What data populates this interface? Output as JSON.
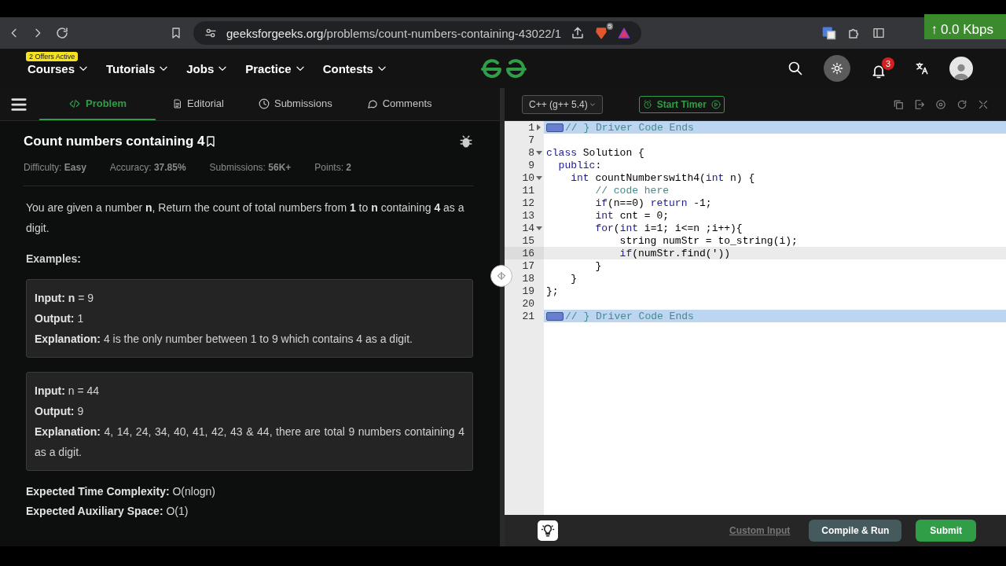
{
  "browser": {
    "url_host": "geeksforgeeks.org",
    "url_path": "/problems/count-numbers-containing-43022/1",
    "shield_count": "5",
    "network_arrow": "↑",
    "network_speed": "0.0 Kbps"
  },
  "nav": {
    "offer_badge": "2 Offers Active",
    "menus": [
      "Courses",
      "Tutorials",
      "Jobs",
      "Practice",
      "Contests"
    ],
    "notification_count": "3"
  },
  "problem_tabs": [
    {
      "label": "Problem",
      "selected": true
    },
    {
      "label": "Editorial",
      "selected": false
    },
    {
      "label": "Submissions",
      "selected": false
    },
    {
      "label": "Comments",
      "selected": false
    }
  ],
  "problem": {
    "title": "Count numbers containing 4",
    "stats": [
      {
        "label": "Difficulty:",
        "value": "Easy"
      },
      {
        "label": "Accuracy:",
        "value": "37.85%"
      },
      {
        "label": "Submissions:",
        "value": "56K+"
      },
      {
        "label": "Points:",
        "value": "2"
      }
    ],
    "description": "You are given a number **n**, Return the count of total numbers from **1** to **n** containing **4** as a digit.",
    "examples_heading": "Examples:",
    "examples": [
      {
        "lines": [
          "**Input:**  **n** = 9",
          "**Output:**  1",
          "**Explanation:** 4 is the only number between 1 to 9 which contains 4 as a digit."
        ]
      },
      {
        "lines": [
          "**Input:** n = 44",
          "**Output:** 9",
          "**Explanation:** 4, 14, 24, 34, 40, 41, 42, 43 & 44, there are total 9 numbers containing 4 as a digit."
        ]
      }
    ],
    "complexity": [
      "**Expected Time Complexity:** O(nlogn)",
      "**Expected Auxiliary Space:** O(1)"
    ]
  },
  "editor": {
    "language": "C++ (g++ 5.4)",
    "timer_button": "Start Timer",
    "lines": [
      {
        "number": "1",
        "foldable": true,
        "expanded": false,
        "highlighted": true,
        "current": false,
        "folded_marker": true,
        "tokens": [
          {
            "text": "// } Driver Code Ends",
            "kind": "comment"
          }
        ]
      },
      {
        "number": "7",
        "foldable": false,
        "highlighted": false,
        "current": false,
        "folded_marker": false
      },
      {
        "number": "8",
        "foldable": true,
        "expanded": true,
        "highlighted": false,
        "current": false,
        "folded_marker": false,
        "tokens": [
          {
            "text": "class",
            "kind": "keyword"
          },
          {
            "text": " Solution {",
            "kind": "plain"
          }
        ]
      },
      {
        "number": "9",
        "foldable": false,
        "highlighted": false,
        "current": false,
        "folded_marker": false,
        "tokens": [
          {
            "text": "  public",
            "kind": "keyword"
          },
          {
            "text": ":",
            "kind": "plain"
          }
        ]
      },
      {
        "number": "10",
        "foldable": true,
        "expanded": true,
        "highlighted": false,
        "current": false,
        "folded_marker": false,
        "tokens": [
          {
            "text": "    int",
            "kind": "keyword"
          },
          {
            "text": " countNumberswith4(",
            "kind": "plain"
          },
          {
            "text": "int",
            "kind": "keyword"
          },
          {
            "text": " n) {",
            "kind": "plain"
          }
        ]
      },
      {
        "number": "11",
        "foldable": false,
        "highlighted": false,
        "current": false,
        "folded_marker": false,
        "tokens": [
          {
            "text": "        // code here",
            "kind": "comment"
          }
        ]
      },
      {
        "number": "12",
        "foldable": false,
        "highlighted": false,
        "current": false,
        "folded_marker": false,
        "tokens": [
          {
            "text": "        if",
            "kind": "keyword"
          },
          {
            "text": "(n==0) ",
            "kind": "plain"
          },
          {
            "text": "return",
            "kind": "keyword"
          },
          {
            "text": " -1;",
            "kind": "plain"
          }
        ]
      },
      {
        "number": "13",
        "foldable": false,
        "highlighted": false,
        "current": false,
        "folded_marker": false,
        "tokens": [
          {
            "text": "        int",
            "kind": "keyword"
          },
          {
            "text": " cnt = 0;",
            "kind": "plain"
          }
        ]
      },
      {
        "number": "14",
        "foldable": true,
        "expanded": true,
        "highlighted": false,
        "current": false,
        "folded_marker": false,
        "tokens": [
          {
            "text": "        for",
            "kind": "keyword"
          },
          {
            "text": "(",
            "kind": "plain"
          },
          {
            "text": "int",
            "kind": "keyword"
          },
          {
            "text": " i=1; i<=n ;i++){",
            "kind": "plain"
          }
        ]
      },
      {
        "number": "15",
        "foldable": false,
        "highlighted": false,
        "current": false,
        "folded_marker": false,
        "tokens": [
          {
            "text": "            string numStr = to_string(i);",
            "kind": "plain"
          }
        ]
      },
      {
        "number": "16",
        "foldable": false,
        "highlighted": false,
        "current": true,
        "folded_marker": false,
        "tokens": [
          {
            "text": "            if",
            "kind": "keyword"
          },
          {
            "text": "(numStr.find('))",
            "kind": "plain"
          }
        ]
      },
      {
        "number": "17",
        "foldable": false,
        "highlighted": false,
        "current": false,
        "folded_marker": false,
        "tokens": [
          {
            "text": "        }",
            "kind": "plain"
          }
        ]
      },
      {
        "number": "18",
        "foldable": false,
        "highlighted": false,
        "current": false,
        "folded_marker": false,
        "tokens": [
          {
            "text": "    }",
            "kind": "plain"
          }
        ]
      },
      {
        "number": "19",
        "foldable": false,
        "highlighted": false,
        "current": false,
        "folded_marker": false,
        "tokens": [
          {
            "text": "};",
            "kind": "plain"
          }
        ]
      },
      {
        "number": "20",
        "foldable": false,
        "highlighted": false,
        "current": false,
        "folded_marker": false
      },
      {
        "number": "21",
        "foldable": false,
        "highlighted": true,
        "current": false,
        "folded_marker": true,
        "tokens": [
          {
            "text": "// } Driver Code Ends",
            "kind": "comment"
          }
        ]
      }
    ],
    "footer": {
      "custom_input": "Custom Input",
      "run_button": "Compile & Run",
      "submit_button": "Submit"
    }
  }
}
